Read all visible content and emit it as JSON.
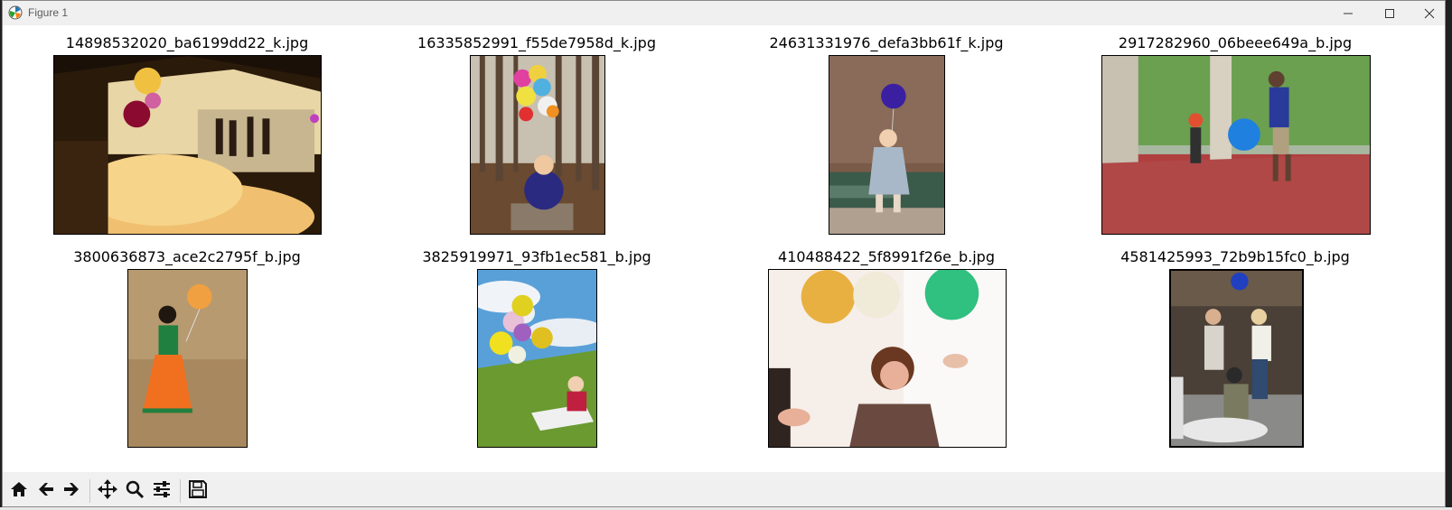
{
  "window": {
    "title": "Figure 1",
    "controls": {
      "minimize": "minimize-icon",
      "maximize": "maximize-icon",
      "close": "close-icon"
    }
  },
  "figure": {
    "images": [
      {
        "filename": "14898532020_ba6199dd22_k.jpg",
        "scene": "evening party tent with balloons"
      },
      {
        "filename": "16335852991_f55de7958d_k.jpg",
        "scene": "toddler with colorful balloons in forest"
      },
      {
        "filename": "24631331976_defa3bb61f_k.jpg",
        "scene": "child with purple balloon on railway cart"
      },
      {
        "filename": "2917282960_06beee649a_b.jpg",
        "scene": "boys playing with blue balloon"
      },
      {
        "filename": "3800636873_ace2c2795f_b.jpg",
        "scene": "girl in orange dress with balloon"
      },
      {
        "filename": "3825919971_93fb1ec581_b.jpg",
        "scene": "baby on grass with yellow balloons"
      },
      {
        "filename": "410488422_5f8991f26e_b.jpg",
        "scene": "woman under balloons"
      },
      {
        "filename": "4581425993_72b9b15fc0_b.jpg",
        "scene": "people on street with scooter"
      }
    ]
  },
  "toolbar": {
    "buttons": [
      "home-icon",
      "back-icon",
      "forward-icon",
      "pan-icon",
      "zoom-icon",
      "configure-subplots-icon",
      "save-icon"
    ]
  },
  "colors": {
    "titlebar": "#f0f0f0",
    "toolbar": "#f0f0f0",
    "canvas": "#ffffff"
  }
}
